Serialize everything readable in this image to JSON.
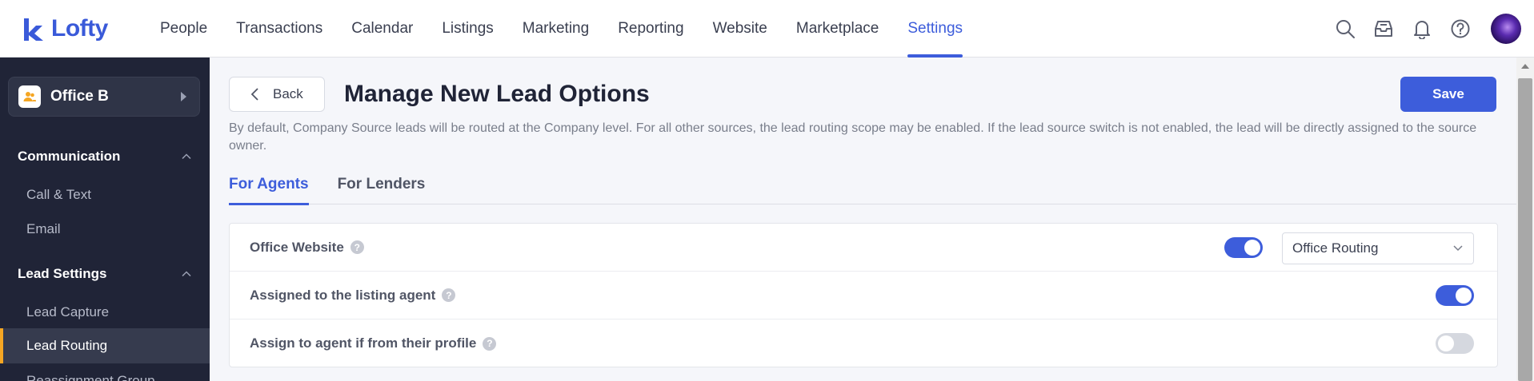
{
  "brand": {
    "name": "Lofty",
    "color": "#3a5ad9"
  },
  "nav": {
    "items": [
      "People",
      "Transactions",
      "Calendar",
      "Listings",
      "Marketing",
      "Reporting",
      "Website",
      "Marketplace",
      "Settings"
    ],
    "active": "Settings",
    "tools": [
      "search-icon",
      "inbox-icon",
      "bell-icon",
      "help-icon"
    ]
  },
  "sidebar": {
    "office": "Office B",
    "sections": [
      {
        "title": "Communication",
        "items": [
          "Call & Text",
          "Email"
        ]
      },
      {
        "title": "Lead Settings",
        "items": [
          "Lead Capture",
          "Lead Routing",
          "Reassignment Group"
        ]
      }
    ],
    "active_item": "Lead Routing"
  },
  "header": {
    "back_label": "Back",
    "title": "Manage New Lead Options",
    "save_label": "Save",
    "description": "By default, Company Source leads will be routed at the Company level. For all other sources, the lead routing scope may be enabled. If the lead source switch is not enabled, the lead will be directly assigned to the source owner."
  },
  "tabs": [
    {
      "label": "For Agents",
      "active": true
    },
    {
      "label": "For Lenders",
      "active": false
    }
  ],
  "options": [
    {
      "label": "Office Website",
      "enabled": true,
      "scope": "Office Routing"
    },
    {
      "label": "Assigned to the listing agent",
      "enabled": true
    },
    {
      "label": "Assign to agent if from their profile",
      "enabled": false
    }
  ],
  "colors": {
    "accent": "#3d5ddb",
    "sidebar_bg": "#202437",
    "active_marker": "#f5a623"
  }
}
